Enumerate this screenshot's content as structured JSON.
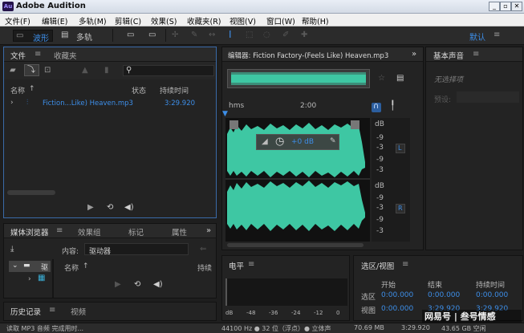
{
  "window": {
    "title": "Adobe Audition",
    "logo": "Au"
  },
  "menu": [
    "文件(F)",
    "编辑(E)",
    "多轨(M)",
    "剪辑(C)",
    "效果(S)",
    "收藏夹(R)",
    "视图(V)",
    "窗口(W)",
    "帮助(H)"
  ],
  "toolbar": {
    "waveform": "波形",
    "multitrack": "多轨",
    "workspace": "默认"
  },
  "files_panel": {
    "tabs": [
      "文件",
      "收藏夹"
    ],
    "columns": [
      "名称",
      "状态",
      "持续时间"
    ],
    "row": {
      "name": "Fiction...Like) Heaven.mp3",
      "duration": "3:29.920"
    }
  },
  "editor": {
    "title": "编辑器: Fiction Factory-(Feels Like) Heaven.mp3",
    "ruler": [
      "hms",
      "2:00"
    ],
    "hud_gain": "+0 dB",
    "db_scale_top": [
      "dB",
      "-9",
      "-3",
      "-9",
      "-3"
    ],
    "db_scale_bottom": [
      "dB",
      "-9",
      "-3",
      "-9",
      "-3"
    ],
    "channels": [
      "L",
      "R"
    ]
  },
  "essential_sound": {
    "title": "基本声音",
    "status": "无选择项",
    "preset_label": "预设:"
  },
  "media_panel": {
    "tabs": [
      "媒体浏览器",
      "效果组",
      "标记",
      "属性"
    ],
    "content_label": "内容:",
    "content_value": "驱动器",
    "col_name": "名称",
    "col_duration": "持续",
    "tree_item": "驱"
  },
  "history_panel": {
    "tabs": [
      "历史记录",
      "视频"
    ]
  },
  "levels_panel": {
    "title": "电平",
    "scale": [
      "dB",
      "-48",
      "-36",
      "-24",
      "-12",
      "0"
    ]
  },
  "selection_panel": {
    "title": "选区/视图",
    "headers": [
      "开始",
      "结束",
      "持续时间"
    ],
    "rows": [
      {
        "label": "选区",
        "start": "0:00.000",
        "end": "0:00.000",
        "dur": "0:00.000"
      },
      {
        "label": "视图",
        "start": "0:00.000",
        "end": "3:29.920",
        "dur": "3:29.920"
      }
    ]
  },
  "status_bar": {
    "message": "读取 MP3 音频 完成用时...",
    "format": "44100 Hz ● 32 位（浮点）● 立体声",
    "size": "70.69 MB",
    "duration": "3:29.920",
    "free": "43.65 GB 空闲"
  },
  "watermark": "网易号 | 叁号情感",
  "colors": {
    "accent": "#3d8ee8",
    "waveform": "#3ec7a3",
    "panel_bg": "#232323"
  }
}
